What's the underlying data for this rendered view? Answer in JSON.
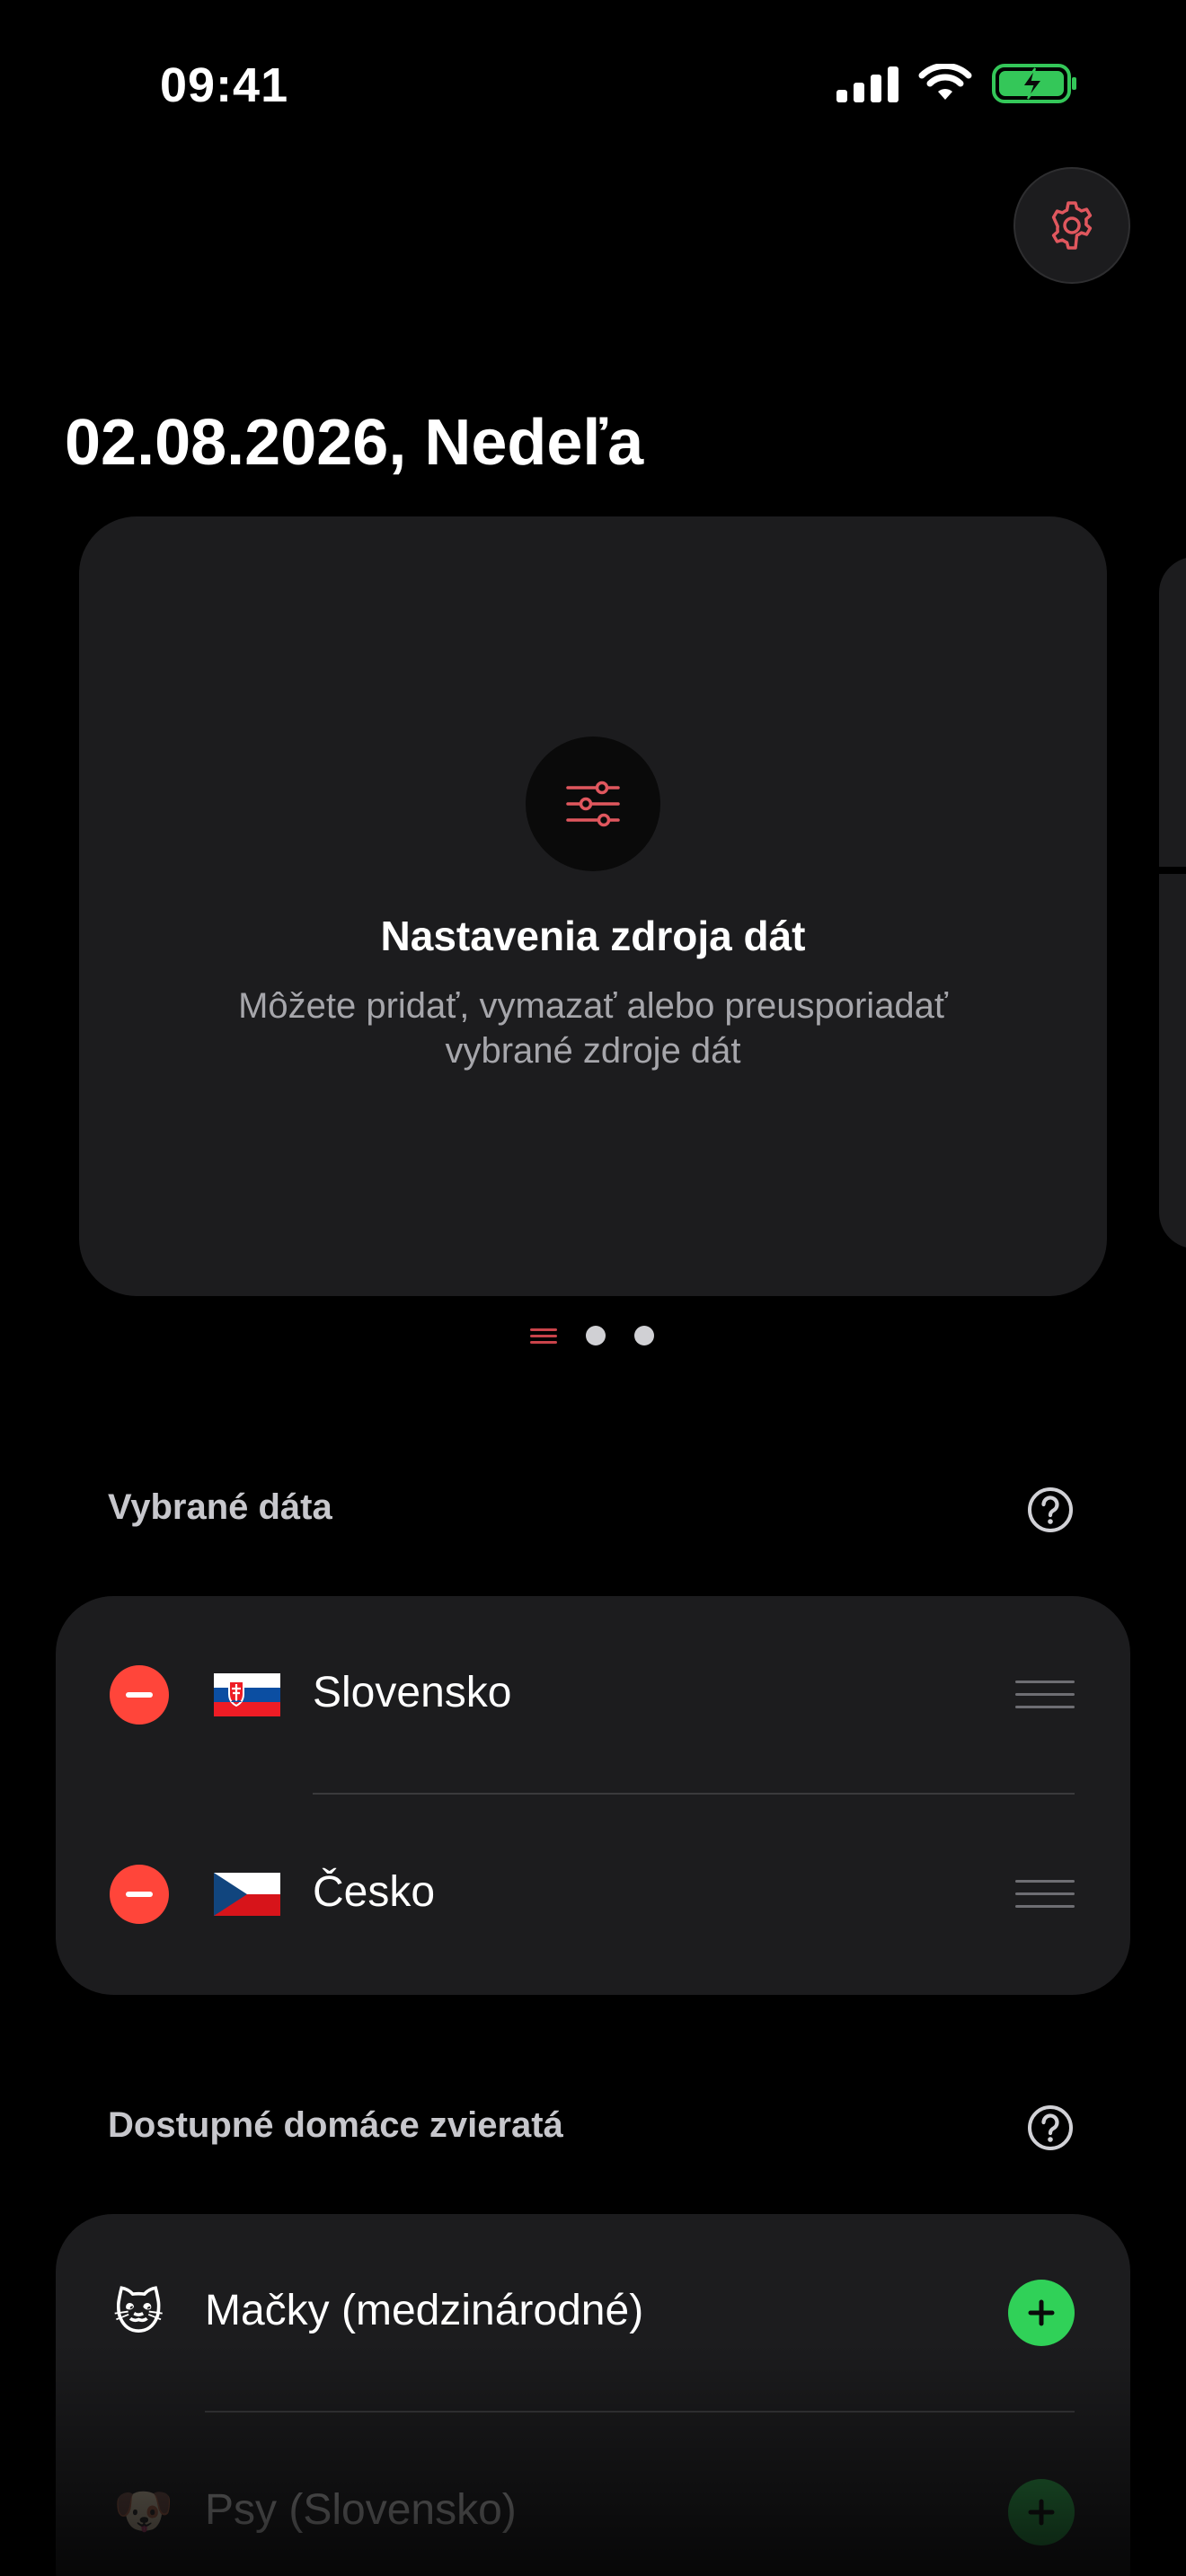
{
  "status_bar": {
    "time": "09:41"
  },
  "header": {
    "date_title": "02.08.2026, Nedeľa"
  },
  "card": {
    "title": "Nastavenia zdroja dát",
    "description": "Môžete pridať, vymazať alebo preusporiadať vybrané zdroje dát",
    "icon": "sliders-icon"
  },
  "pager": {
    "count": 3,
    "current": 0
  },
  "selected": {
    "header": "Vybrané dáta",
    "items": [
      {
        "label": "Slovensko",
        "flag": "slovakia-flag"
      },
      {
        "label": "Česko",
        "flag": "czech-flag"
      }
    ]
  },
  "available": {
    "header": "Dostupné domáce zvieratá",
    "items": [
      {
        "label": "Mačky (medzinárodné)",
        "emoji": "🐱"
      },
      {
        "label": "Psy (Slovensko)",
        "emoji": "🐶"
      }
    ]
  },
  "colors": {
    "accent": "#e0575e",
    "remove": "#ff453a",
    "add": "#30d158",
    "card": "#1c1c1e"
  }
}
